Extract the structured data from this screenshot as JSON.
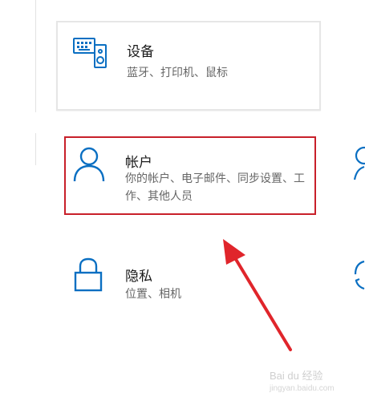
{
  "settings": {
    "tiles": [
      {
        "title": "设备",
        "subtitle": "蓝牙、打印机、鼠标",
        "icon": "keyboard-speaker-icon"
      },
      {
        "title": "帐户",
        "subtitle": "你的帐户、电子邮件、同步设置、工作、其他人员",
        "icon": "person-icon"
      },
      {
        "title": "隐私",
        "subtitle": "位置、相机",
        "icon": "lock-icon"
      }
    ]
  },
  "annotation": {
    "color": "#c8202a"
  },
  "watermark": {
    "brand": "Bai du 经验",
    "url": "jingyan.baidu.com"
  },
  "accent": "#0a6fc2"
}
